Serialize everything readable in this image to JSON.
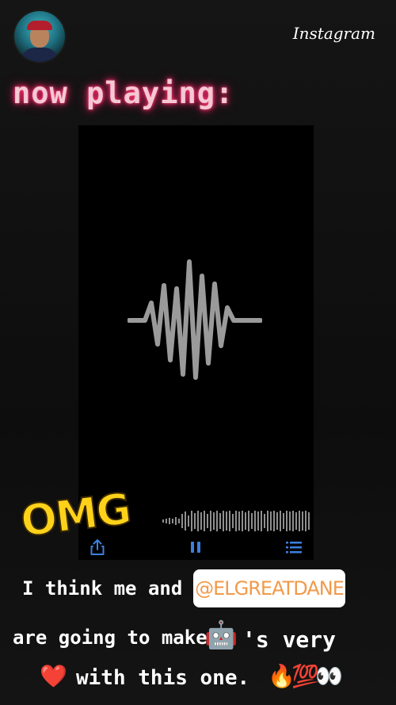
{
  "header": {
    "brand": "Instagram"
  },
  "story": {
    "heading": "now playing:",
    "sticker": "OMG",
    "caption": {
      "line1": "I think me and",
      "mention": "@ELGREATDANE",
      "line2_start": "are going to make",
      "line2_end": "'s very",
      "line3": "with this one."
    },
    "emojis": {
      "robot": "🤖",
      "heart": "❤️",
      "fire": "🔥",
      "hundred": "💯",
      "eyes": "👀"
    }
  },
  "player": {
    "icons": [
      "share-icon",
      "pause-icon",
      "list-icon"
    ],
    "accent": "#3d7fe0",
    "wave_color": "#9a9a9a"
  }
}
